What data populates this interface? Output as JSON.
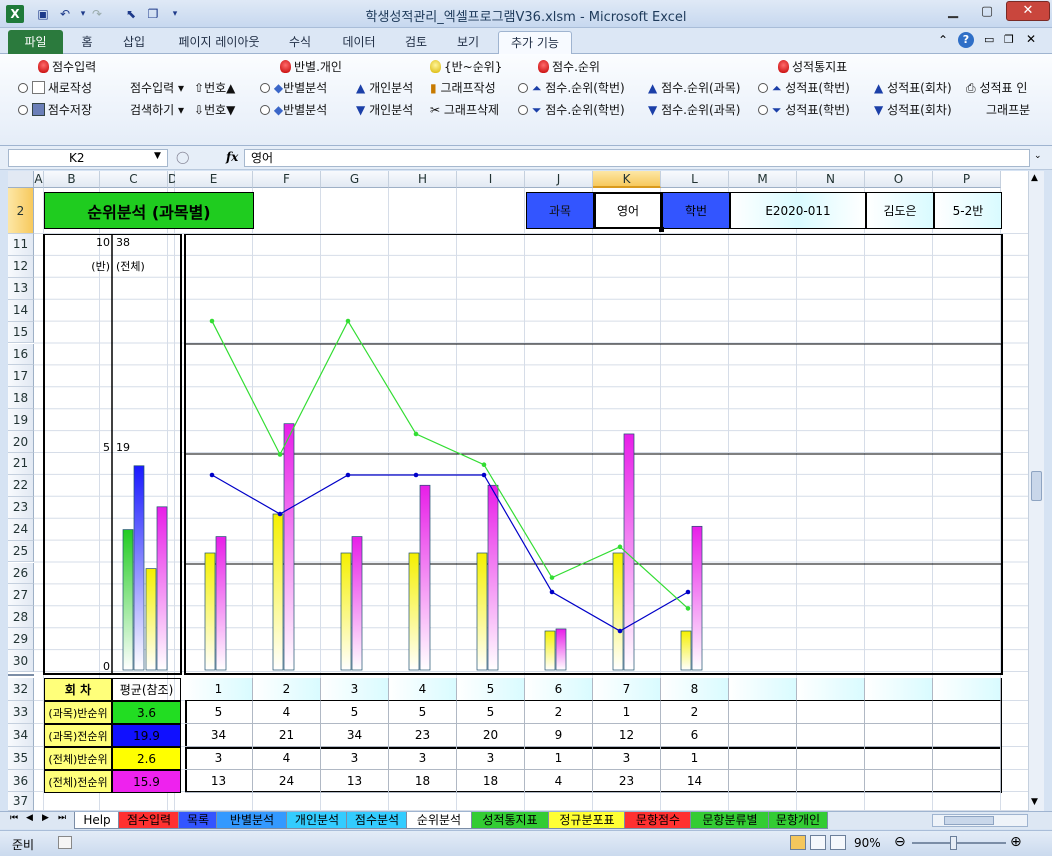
{
  "window": {
    "title": "학생성적관리_엑셀프로그램V36.xlsm  -  Microsoft Excel"
  },
  "ribbon_tabs": [
    "파일",
    "홈",
    "삽입",
    "페이지 레이아웃",
    "수식",
    "데이터",
    "검토",
    "보기",
    "추가 기능"
  ],
  "ribbon": {
    "g1": {
      "header": "점수입력",
      "r1": "새로작성",
      "r2": "점수저장",
      "c1": "점수입력 ▾",
      "c2": "검색하기 ▾",
      "d1": "번호▲",
      "d2": "번호▼"
    },
    "g2": {
      "header": "반별.개인",
      "r1": "반별분석",
      "r2": "반별분석",
      "d1": "개인분석",
      "d2": "개인분석"
    },
    "g3": {
      "header": "{반~순위}",
      "r1": "그래프작성",
      "r2": "그래프삭제"
    },
    "g4": {
      "header": "점수.순위",
      "r1": "점수.순위(학번)",
      "r2": "점수.순위(학번)",
      "d1": "점수.순위(과목)",
      "d2": "점수.순위(과목)"
    },
    "g5": {
      "header": "성적통지표",
      "r1": "성적표(학번)",
      "r2": "성적표(학번)",
      "d1": "성적표(회차)",
      "d2": "성적표(회차)",
      "e1": "성적표 인",
      "e2": "그래프분"
    }
  },
  "formula_bar": {
    "name_box": "K2",
    "fx": "fx",
    "value": "영어"
  },
  "columns": [
    "A",
    "B",
    "C",
    "D",
    "E",
    "F",
    "G",
    "H",
    "I",
    "J",
    "K",
    "L",
    "M",
    "N",
    "O",
    "P"
  ],
  "rows": [
    "2",
    "11",
    "12",
    "13",
    "14",
    "15",
    "16",
    "17",
    "18",
    "19",
    "20",
    "21",
    "22",
    "23",
    "24",
    "25",
    "26",
    "27",
    "28",
    "29",
    "30",
    "32",
    "33",
    "34",
    "35",
    "36",
    "37"
  ],
  "header_row": {
    "title": "순위분석 (과목별)",
    "subject_label": "과목",
    "subject_value": "영어",
    "id_label": "학번",
    "id_value": "E2020-011",
    "name": "김도은",
    "class": "5-2반"
  },
  "left_axis": {
    "top_ban": "10",
    "top_all": "38",
    "label_ban": "(반)",
    "label_all": "(전체)",
    "mid_ban": "5",
    "mid_all": "19",
    "zero": "0"
  },
  "table": {
    "round_label": "회 차",
    "avg_label": "평균(참조)",
    "rounds": [
      "1",
      "2",
      "3",
      "4",
      "5",
      "6",
      "7",
      "8"
    ],
    "rows": [
      {
        "label": "(과목)반순위",
        "avg": "3.6",
        "values": [
          "5",
          "4",
          "5",
          "5",
          "5",
          "2",
          "1",
          "2"
        ]
      },
      {
        "label": "(과목)전순위",
        "avg": "19.9",
        "values": [
          "34",
          "21",
          "34",
          "23",
          "20",
          "9",
          "12",
          "6"
        ]
      },
      {
        "label": "(전체)반순위",
        "avg": "2.6",
        "values": [
          "3",
          "4",
          "3",
          "3",
          "3",
          "1",
          "3",
          "1"
        ]
      },
      {
        "label": "(전체)전순위",
        "avg": "15.9",
        "values": [
          "13",
          "24",
          "13",
          "18",
          "18",
          "4",
          "23",
          "14"
        ]
      }
    ]
  },
  "chart_data": {
    "type": "bar",
    "categories": [
      "1",
      "2",
      "3",
      "4",
      "5",
      "6",
      "7",
      "8"
    ],
    "ylim_ban": [
      0,
      10
    ],
    "ylim_all": [
      0,
      38
    ],
    "series": [
      {
        "values": [
          5,
          4,
          5,
          5,
          5,
          2,
          1,
          2
        ],
        "scale": "ban",
        "mark": "line",
        "color": "#0000c8"
      },
      {
        "values": [
          34,
          21,
          34,
          23,
          20,
          9,
          12,
          6
        ],
        "scale": "all",
        "mark": "line",
        "color": "#33dd33"
      },
      {
        "values": [
          3,
          4,
          3,
          3,
          3,
          1,
          3,
          1
        ],
        "scale": "ban",
        "mark": "bar",
        "color": "#f5f000"
      },
      {
        "values": [
          13,
          24,
          13,
          18,
          18,
          4,
          23,
          14
        ],
        "scale": "all",
        "mark": "bar",
        "color": "#e81ee8"
      }
    ],
    "avg_bars": [
      {
        "value": 3.6,
        "scale": "ban",
        "color": "#22cc22"
      },
      {
        "value": 19.9,
        "scale": "all",
        "color": "#1a1aff"
      },
      {
        "value": 2.6,
        "scale": "ban",
        "color": "#f5f000"
      },
      {
        "value": 15.9,
        "scale": "all",
        "color": "#e81ee8"
      }
    ]
  },
  "sheet_tabs": [
    "Help",
    "점수입력",
    "목록",
    "반별분석",
    "개인분석",
    "점수분석",
    "순위분석",
    "성적통지표",
    "정규분포표",
    "문항점수",
    "문항분류별",
    "문항개인"
  ],
  "active_sheet": "순위분석",
  "status": {
    "ready": "준비",
    "zoom": "90%"
  },
  "colors": {
    "title_bg": "#1fcc1f",
    "title_text": "#000",
    "label_blue": "#3355ff",
    "header_cyan": "#d9fbff",
    "row_label_yellow": "#ffff7a"
  }
}
